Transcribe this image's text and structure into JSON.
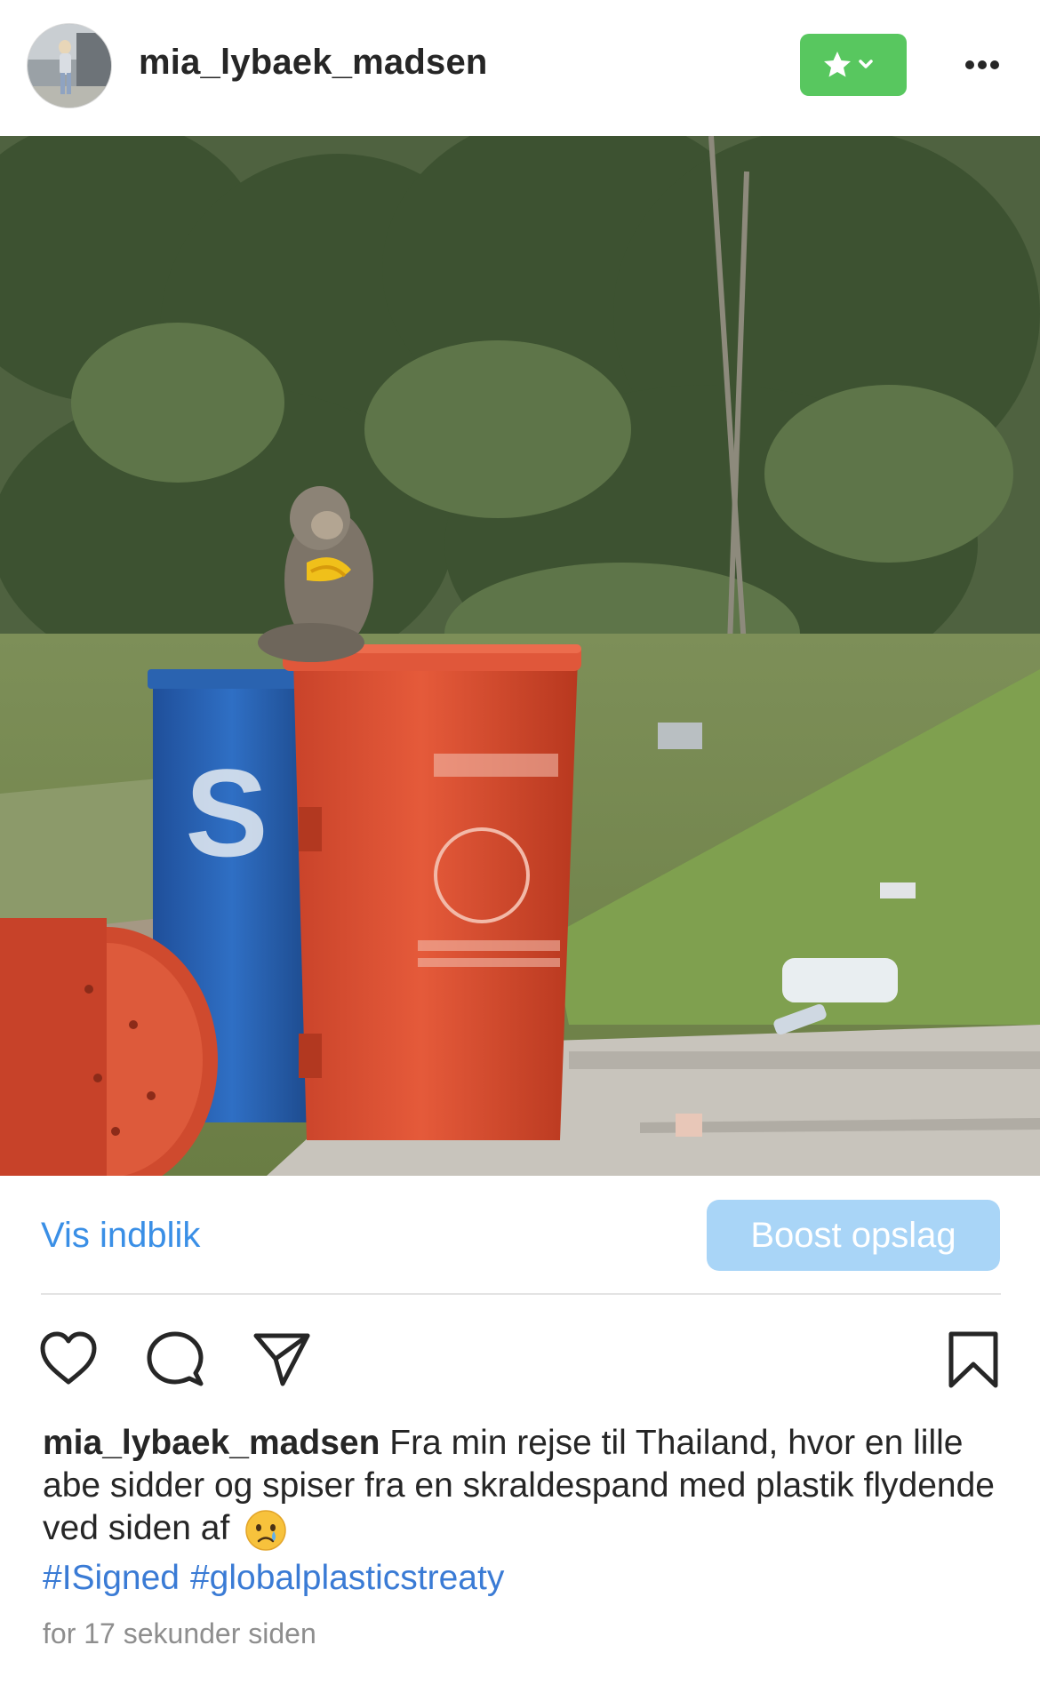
{
  "header": {
    "username": "mia_lybaek_madsen",
    "favorite_button_icon": "star-chevron-icon",
    "more_icon": "more-horizontal-icon"
  },
  "post": {
    "image_icon": "post-photo"
  },
  "insights": {
    "view_insights_label": "Vis indblik",
    "boost_label": "Boost opslag"
  },
  "actions": {
    "like_icon": "heart-icon",
    "comment_icon": "comment-icon",
    "share_icon": "send-icon",
    "save_icon": "bookmark-icon"
  },
  "caption": {
    "username": "mia_lybaek_madsen",
    "text": "Fra min rejse til Thailand, hvor en lille abe sidder og spiser fra en skraldespand med plastik flydende ved siden af",
    "emoji_icon": "crying-face-emoji",
    "hashtags": [
      "#ISigned",
      "#globalplasticstreaty"
    ]
  },
  "timestamp": "for 17 sekunder siden",
  "colors": {
    "favorite_green": "#58c75f",
    "link_blue": "#3a8fe6",
    "boost_bg": "#a9d5f7",
    "hashtag_blue": "#3a7bd5",
    "muted": "#8e8e8e"
  }
}
